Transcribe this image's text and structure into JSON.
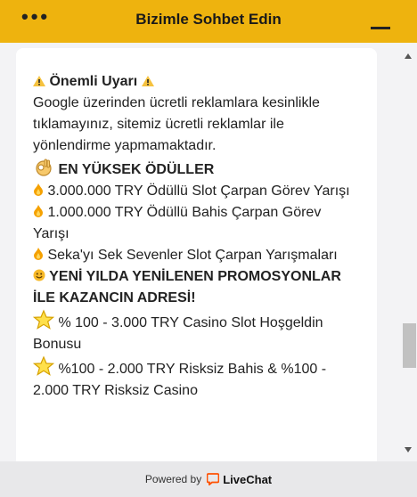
{
  "header": {
    "menu_icon": "•••",
    "title": "Bizimle Sohbet Edin",
    "color": "#eeb30e"
  },
  "message": {
    "warning_title": "Önemli Uyarı",
    "warning_text": "Google üzerinden ücretli reklamlara kesinlikle tıklamayınız, sitemiz ücretli reklamlar ile yönlendirme yapmamaktadır.",
    "awards_heading": "EN YÜKSEK ÖDÜLLER",
    "awards": [
      "3.000.000 TRY Ödüllü Slot Çarpan Görev Yarışı",
      "1.000.000 TRY Ödüllü Bahis Çarpan Görev Yarışı",
      "Seka'yı Sek Sevenler Slot Çarpan Yarışmaları"
    ],
    "promo_heading": "YENİ YILDA YENİLENEN PROMOSYONLAR İLE KAZANCIN ADRESİ!",
    "promos": [
      "% 100 - 3.000 TRY Casino Slot Hoşgeldin Bonusu",
      "%100 - 2.000 TRY Risksiz Bahis & %100 - 2.000 TRY Risksiz Casino"
    ]
  },
  "footer": {
    "powered_by": "Powered by",
    "brand": "LiveChat",
    "brand_color": "#ff5100"
  }
}
